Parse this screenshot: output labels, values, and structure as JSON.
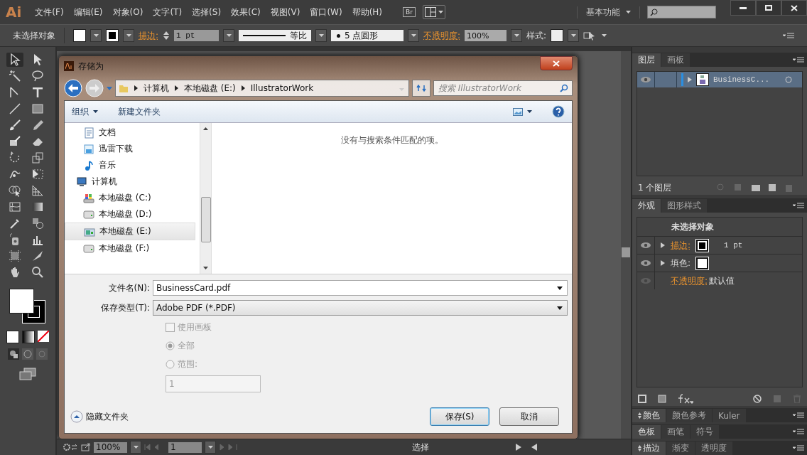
{
  "app": {
    "logo": "Ai",
    "bridge": "Br",
    "workspace": "基本功能"
  },
  "menu": [
    "文件(F)",
    "编辑(E)",
    "对象(O)",
    "文字(T)",
    "选择(S)",
    "效果(C)",
    "视图(V)",
    "窗口(W)",
    "帮助(H)"
  ],
  "control_bar": {
    "selection": "未选择对象",
    "stroke_label": "描边:",
    "stroke_weight": "1 pt",
    "profile": "等比",
    "brush": "5 点圆形",
    "opacity_label": "不透明度:",
    "opacity": "100%",
    "style_label": "样式:"
  },
  "dialog": {
    "title": "存储为",
    "breadcrumb": [
      "计算机",
      "本地磁盘 (E:)",
      "IllustratorWork"
    ],
    "search_placeholder": "搜索 IllustratorWork",
    "toolbar": {
      "organize": "组织",
      "new_folder": "新建文件夹"
    },
    "nav": [
      {
        "label": "文档",
        "kind": "document",
        "selected": false
      },
      {
        "label": "迅雷下载",
        "kind": "download",
        "selected": false
      },
      {
        "label": "音乐",
        "kind": "music",
        "selected": false
      },
      {
        "label": "计算机",
        "kind": "computer",
        "selected": false,
        "children": [
          {
            "label": "本地磁盘 (C:)",
            "kind": "system-drive",
            "selected": false
          },
          {
            "label": "本地磁盘 (D:)",
            "kind": "drive",
            "selected": false
          },
          {
            "label": "本地磁盘 (E:)",
            "kind": "custom-drive",
            "selected": true
          },
          {
            "label": "本地磁盘 (F:)",
            "kind": "drive",
            "selected": false
          }
        ]
      }
    ],
    "empty_message": "没有与搜索条件匹配的项。",
    "file_name_label": "文件名(N):",
    "file_name": "BusinessCard.pdf",
    "save_type_label": "保存类型(T):",
    "save_type": "Adobe PDF (*.PDF)",
    "options": [
      {
        "kind": "checkbox",
        "label": "使用画板",
        "checked": false,
        "disabled": true
      },
      {
        "kind": "radio",
        "label": "全部",
        "selected": true,
        "disabled": true
      },
      {
        "kind": "radio",
        "label": "范围:",
        "selected": false,
        "disabled": true
      }
    ],
    "range_value": "1",
    "hide_folders": "隐藏文件夹",
    "buttons": [
      {
        "label": "保存(S)",
        "default": true
      },
      {
        "label": "取消",
        "default": false
      }
    ]
  },
  "layers_panel": {
    "tabs": [
      {
        "label": "图层",
        "selected": true
      },
      {
        "label": "画板",
        "selected": false
      }
    ],
    "layers": [
      {
        "name": "BusinessC...",
        "selected": true
      }
    ],
    "count": "1 个图层"
  },
  "appearance_panel": {
    "tabs": [
      {
        "label": "外观",
        "selected": true
      },
      {
        "label": "图形样式",
        "selected": false
      }
    ],
    "title": "未选择对象",
    "rows": [
      {
        "kind": "stroke",
        "label": "描边:",
        "value": "1 pt"
      },
      {
        "kind": "fill",
        "label": "填色:"
      },
      {
        "kind": "opacity",
        "label": "不透明度:",
        "value": "默认值"
      }
    ]
  },
  "collapsed_panels": [
    {
      "tabs": [
        {
          "label": "颜色",
          "selected": true
        },
        {
          "label": "颜色参考",
          "selected": false
        },
        {
          "label": "Kuler",
          "selected": false
        }
      ]
    },
    {
      "tabs": [
        {
          "label": "色板",
          "selected": true
        },
        {
          "label": "画笔",
          "selected": false
        },
        {
          "label": "符号",
          "selected": false
        }
      ]
    },
    {
      "tabs": [
        {
          "label": "描边",
          "selected": true
        },
        {
          "label": "渐变",
          "selected": false
        },
        {
          "label": "透明度",
          "selected": false
        }
      ]
    }
  ],
  "status_bar": {
    "zoom": "100%",
    "artboard": "1",
    "tool": "选择"
  }
}
